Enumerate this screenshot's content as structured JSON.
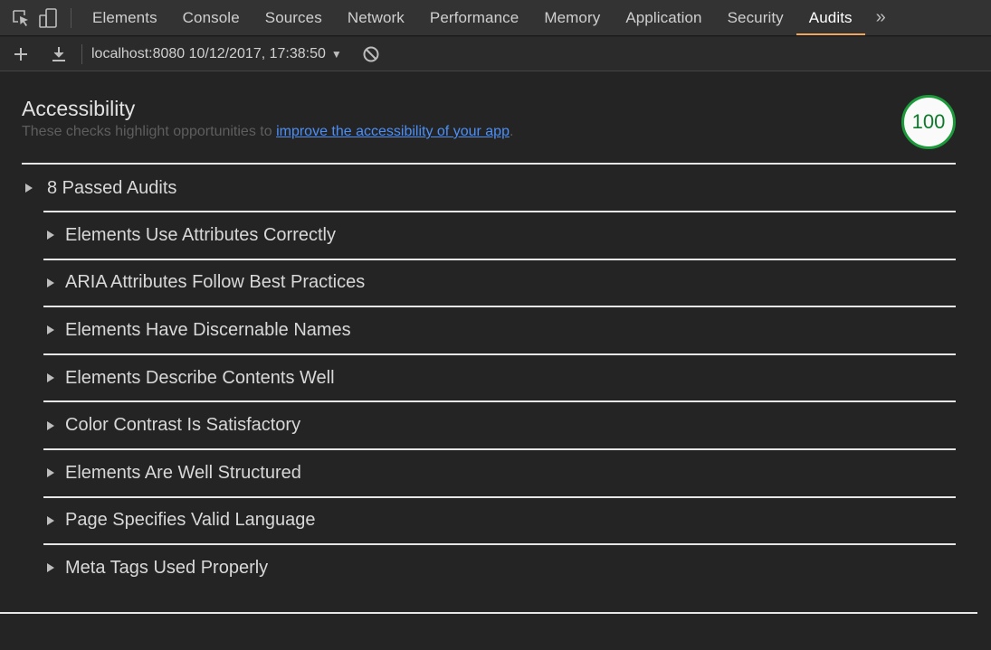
{
  "tabs": {
    "items": [
      "Elements",
      "Console",
      "Sources",
      "Network",
      "Performance",
      "Memory",
      "Application",
      "Security",
      "Audits"
    ],
    "active": "Audits",
    "more_label": "»"
  },
  "toolbar": {
    "add_icon": "plus-icon",
    "download_icon": "download-icon",
    "report_label": "localhost:8080 10/12/2017, 17:38:50",
    "report_caret": "▼",
    "clear_icon": "block-icon"
  },
  "category": {
    "title": "Accessibility",
    "desc_prefix": "These checks highlight opportunities to ",
    "desc_link": "improve the accessibility of your app",
    "desc_suffix": ".",
    "score": "100",
    "score_color": "#1c9a3a"
  },
  "passed": {
    "label": "8 Passed Audits",
    "groups": [
      "Elements Use Attributes Correctly",
      "ARIA Attributes Follow Best Practices",
      "Elements Have Discernable Names",
      "Elements Describe Contents Well",
      "Color Contrast Is Satisfactory",
      "Elements Are Well Structured",
      "Page Specifies Valid Language",
      "Meta Tags Used Properly"
    ]
  },
  "colors": {
    "accent_tab": "#f0a55b",
    "link": "#4d8ff5",
    "background": "#242424"
  }
}
